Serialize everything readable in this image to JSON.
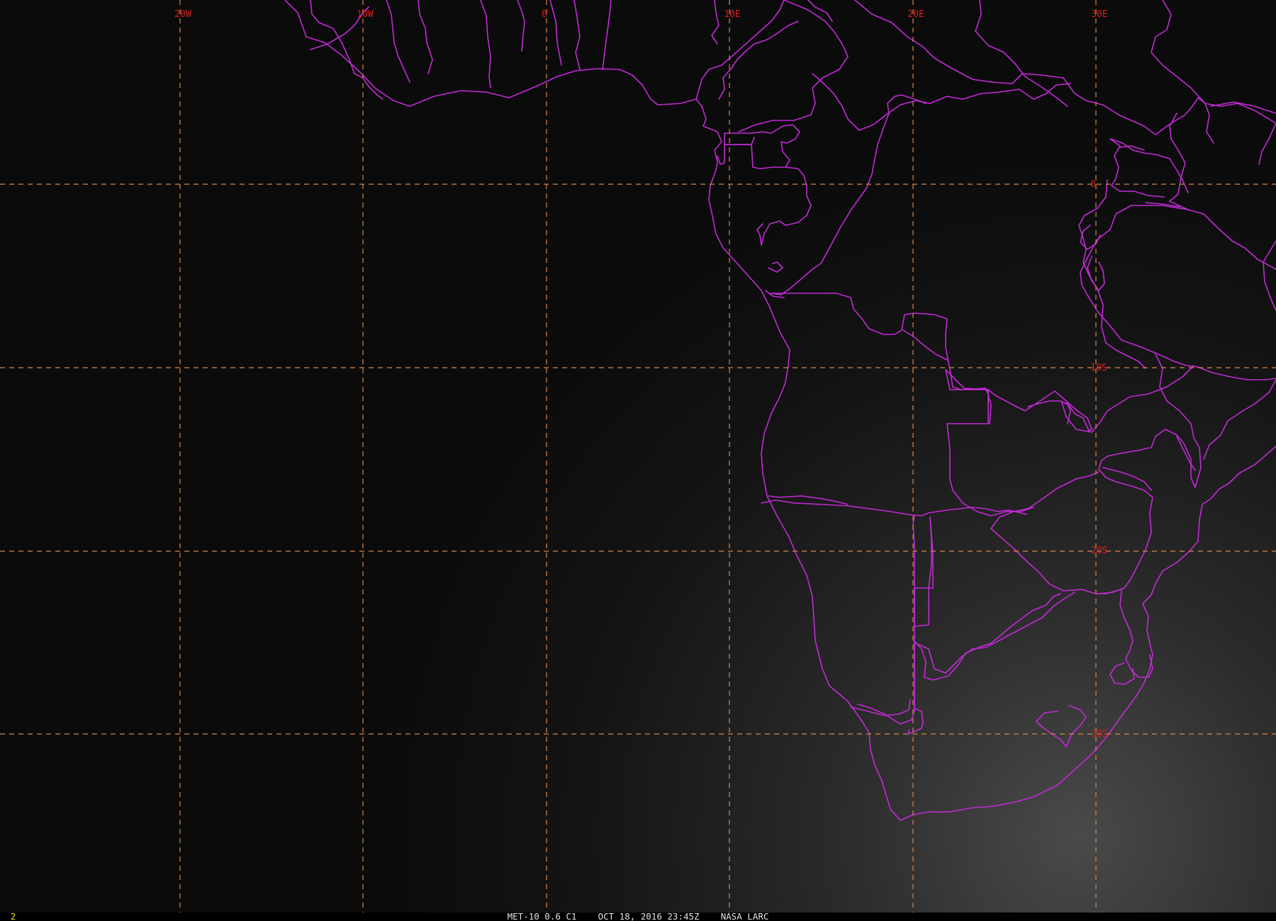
{
  "map": {
    "longitude_labels": [
      "20W",
      "10W",
      "0",
      "10E",
      "20E",
      "30E"
    ],
    "latitude_labels": [
      "0",
      "10S",
      "20S",
      "30S"
    ],
    "colors": {
      "background": "#000000",
      "grid": "#d9894a",
      "labels": "#d81e1e",
      "boundaries": "#c22ad6",
      "status_text": "#e2e2e2",
      "frame_number": "#e8e800"
    }
  },
  "status_bar": {
    "frame_number": "2",
    "caption": "MET-10 0.6 C1    OCT 18, 2016 23:45Z    NASA LARC"
  }
}
